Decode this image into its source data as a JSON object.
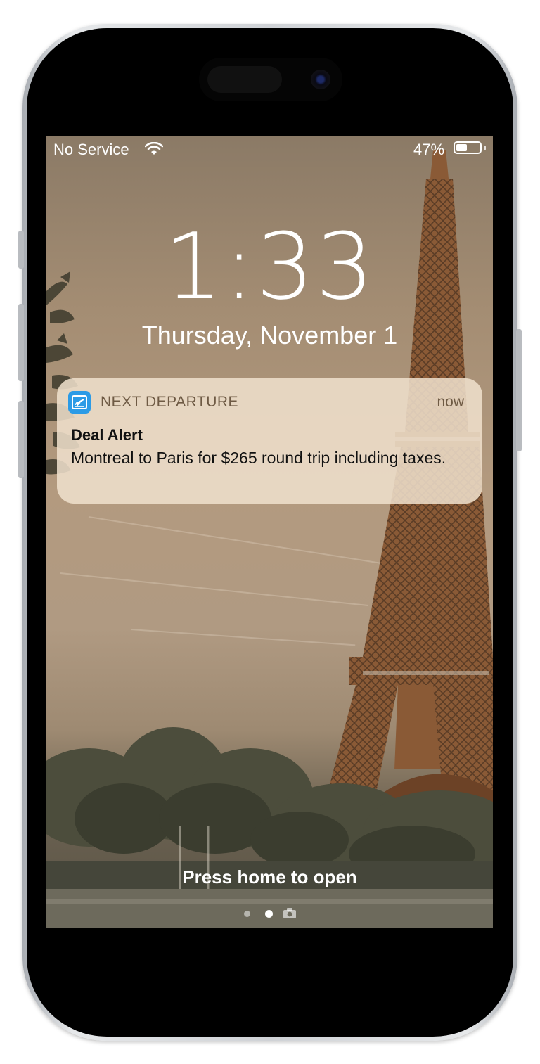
{
  "status_bar": {
    "carrier": "No Service",
    "battery_percent": "47%",
    "battery_level": 0.47,
    "wifi_icon": "wifi-icon",
    "battery_icon": "battery-icon"
  },
  "lock_screen": {
    "time": "1:33",
    "date": "Thursday, November 1",
    "hint": "Press home to open",
    "pages": [
      "dot",
      "dot-active",
      "camera-icon"
    ]
  },
  "notification": {
    "app_icon": "airplane-ticket-icon",
    "app_name": "NEXT DEPARTURE",
    "time": "now",
    "title": "Deal Alert",
    "body": "Montreal to Paris for $265 round trip including taxes."
  },
  "colors": {
    "notification_bg": "#f0e1cd",
    "app_icon": "#2c9be6",
    "app_name_text": "#6e5a44"
  }
}
